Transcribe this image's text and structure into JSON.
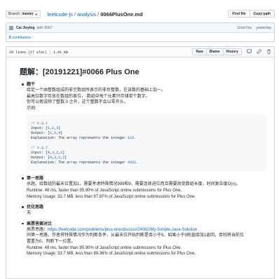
{
  "breadcrumb": {
    "branch_label": "Branch:",
    "branch_name": "master",
    "repo": "leetcode-js",
    "sep1": "/",
    "folder": "analysis",
    "sep2": "/",
    "file": "0066PlusOne.md"
  },
  "top_actions": {
    "find_file": "Find file",
    "copy_path": "Copy path"
  },
  "commit": {
    "author": "Cai Jieying",
    "message": "add: 0067",
    "sha": "32e978a",
    "time": "yesterday",
    "contributors_count": "0",
    "contributors_label": "contributors"
  },
  "file_header": {
    "lines": "29 lines (27 sloc)",
    "size": "1.41 KB",
    "raw": "Raw",
    "blame": "Blame",
    "history": "History",
    "icons": [
      "desktop-icon",
      "pencil-icon",
      "trash-icon"
    ]
  },
  "doc": {
    "title": "题解：[20191221]#0066 Plus One",
    "sections": [
      {
        "title": "题干",
        "lines": [
          "给定一个由整数组成的非空数组所表示的非负整数，在该数的基础上加一。",
          "最高位数字存放在数组的首位， 数组中每个元素只存储单个数字。",
          "你可以假设除了整数 0 之外，这个整数不会以零开头。",
          "示例:"
        ],
        "code": {
          "ex1_comment": "// e.g.1",
          "ex1_input_label": "Input: [",
          "ex1_input": [
            "1",
            "2",
            "3"
          ],
          "ex1_output_label": "Output: [",
          "ex1_output": [
            "1",
            "2",
            "4"
          ],
          "ex1_expl": "Explanation: The array represents the integer ",
          "ex1_int": "123",
          "ex2_comment": "// e.g.2",
          "ex2_input_label": "Input: [",
          "ex2_input": [
            "4",
            "3",
            "2",
            "1"
          ],
          "ex2_output_label": "Output: [",
          "ex2_output": [
            "4",
            "3",
            "2",
            "2"
          ],
          "ex2_expl": "Explanation: The array represents the integer ",
          "ex2_int": "4321",
          "comma": ",",
          "close": "]",
          "dot": "."
        }
      },
      {
        "title": "第一思路",
        "lines": [
          "水题。给数组的最末位置加1，需要考虑特殊情况999和9，需要连续进位而且需要改变数组长度，时间复杂度O(n)。",
          "Runtime: 48 ms, faster than 95.90% of JavaScript online submissions for Plus One.",
          "Memory Usage: 33.7 MB, less than 97.87% of JavaScript online submissions for Plus One."
        ]
      },
      {
        "title": "优化思路",
        "lines": [
          "无"
        ]
      },
      {
        "title": "高票答案对比",
        "link_prefix": "高票思路：",
        "link": "https://leetcode.com/problems/plus-one/discuss/24082/My-Simple-Java-Solution",
        "lines": [
          "同第一思路，作者将特殊情况作为判断条件，从最末位开始判断是否小于9，如果小于9则直接加1返回，否则将当前位",
          "置置为0，判断下一位置。",
          "Runtime: 48 ms, faster than 95.90% of JavaScript online submissions for Plus One.",
          "Memory Usage: 33.7 MB, less than 89.36% of JavaScript online submissions for Plus One."
        ]
      }
    ]
  }
}
